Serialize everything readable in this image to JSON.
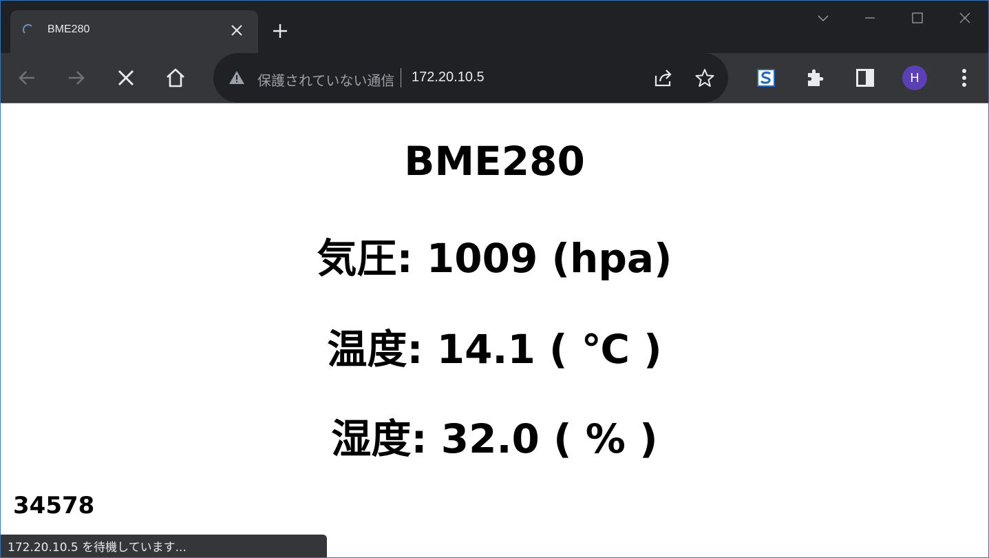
{
  "tab": {
    "title": "BME280"
  },
  "omnibox": {
    "security_text": "保護されていない通信",
    "url": "172.20.10.5"
  },
  "profile": {
    "initial": "H",
    "color": "#5b3fb5"
  },
  "page": {
    "heading": "BME280",
    "pressure": "気圧: 1009 (hpa)",
    "temperature": "温度: 14.1 ( ℃ )",
    "humidity": "湿度: 32.0 ( % )",
    "counter": "34578"
  },
  "status": {
    "text": "172.20.10.5 を待機しています..."
  },
  "icons": {
    "tab_loading": "loading-spinner-icon",
    "tab_close": "close-icon",
    "new_tab": "plus-icon",
    "back": "arrow-left-icon",
    "forward": "arrow-right-icon",
    "stop": "close-icon",
    "home": "home-icon",
    "warning": "warning-icon",
    "share": "share-icon",
    "bookmark": "star-icon",
    "extension_s": "s-extension-icon",
    "extensions": "puzzle-icon",
    "side_panel": "side-panel-icon",
    "menu": "kebab-menu-icon"
  }
}
